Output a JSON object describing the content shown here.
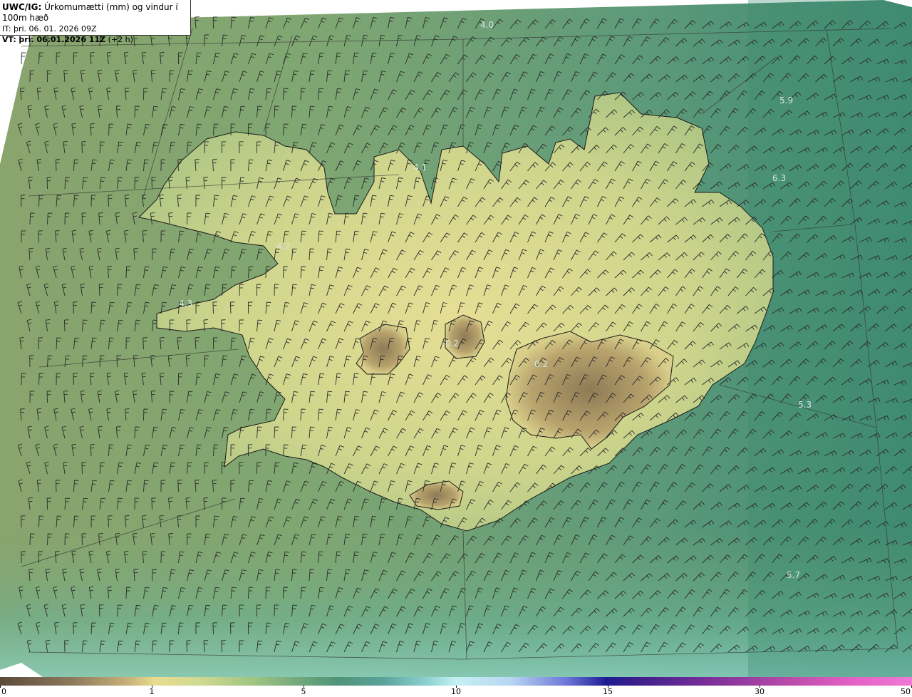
{
  "header": {
    "title_prefix": "UWC/IG:",
    "title_text": "Úrkomumætti (mm) og vindur í 100m hæð",
    "it_label": "IT:",
    "it_value": "þri. 06. 01. 2026 09Z",
    "vt_label": "VT:",
    "vt_value": "þri. 06.01.2026 11Z",
    "vt_suffix": "(+2 h)"
  },
  "map_labels": [
    {
      "id": "l1",
      "text": "4.0"
    },
    {
      "id": "l2",
      "text": "5.9"
    },
    {
      "id": "l3",
      "text": "6.3"
    },
    {
      "id": "l4",
      "text": "4.1"
    },
    {
      "id": "l5",
      "text": "4.2"
    },
    {
      "id": "l6",
      "text": "4.3"
    },
    {
      "id": "l7",
      "text": "0.2"
    },
    {
      "id": "l8",
      "text": "0.2"
    },
    {
      "id": "l9",
      "text": "5.3"
    },
    {
      "id": "l10",
      "text": "5.7"
    }
  ],
  "colorbar": {
    "ticks": [
      "0",
      "1",
      "5",
      "10",
      "15",
      "30",
      "50"
    ]
  },
  "colors": {
    "land_low": "#e8dc8f",
    "glacier": "#9a8458",
    "sea": "#4f9479",
    "sea_deep": "#3f8c74",
    "coast": "#1a1a1a"
  }
}
